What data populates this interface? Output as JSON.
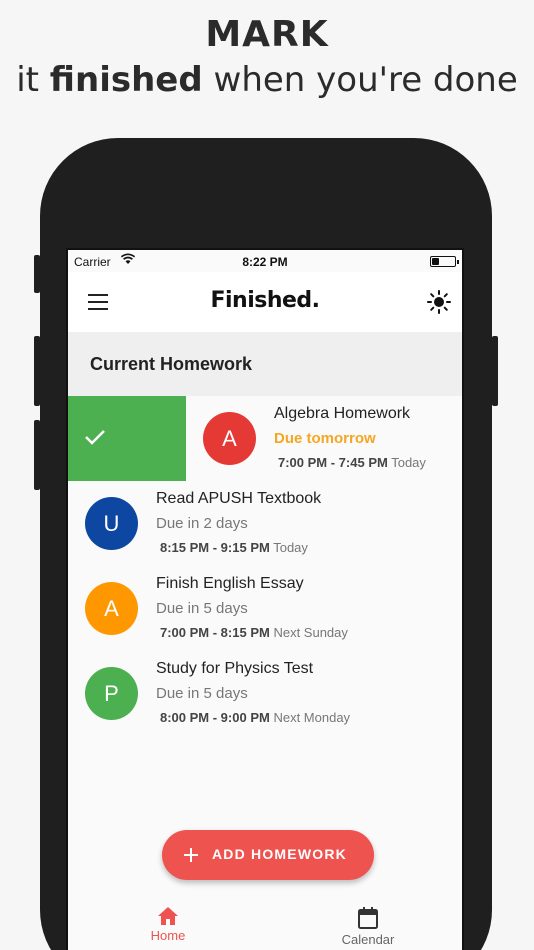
{
  "promo": {
    "headline_top": "MARK",
    "headline_pre": "it ",
    "headline_bold": "finished",
    "headline_post": " when you're done"
  },
  "status_bar": {
    "carrier": "Carrier",
    "time": "8:22 PM",
    "battery_level": 0.3
  },
  "app_bar": {
    "title": "Finished.",
    "left_icon": "menu-icon",
    "right_icon": "sun-icon"
  },
  "section": {
    "title": "Current Homework"
  },
  "homework": [
    {
      "initial": "A",
      "name": "Algebra Homework",
      "due": "Due tomorrow",
      "time_range": "7:00 PM - 7:45 PM",
      "day": "Today",
      "color": "#e53935",
      "urgent": true,
      "swiped": true
    },
    {
      "initial": "U",
      "name": "Read APUSH Textbook",
      "due": "Due in 2 days",
      "time_range": "8:15 PM - 9:15 PM",
      "day": "Today",
      "color": "#0d47a1",
      "urgent": false,
      "swiped": false
    },
    {
      "initial": "A",
      "name": "Finish English Essay",
      "due": "Due in 5 days",
      "time_range": "7:00 PM - 8:15 PM",
      "day": "Next Sunday",
      "color": "#ff9800",
      "urgent": false,
      "swiped": false
    },
    {
      "initial": "P",
      "name": "Study for Physics Test",
      "due": "Due in 5 days",
      "time_range": "8:00 PM - 9:00 PM",
      "day": "Next Monday",
      "color": "#4caf50",
      "urgent": false,
      "swiped": false
    }
  ],
  "fab": {
    "label": "ADD HOMEWORK",
    "icon": "plus-icon"
  },
  "bottom_nav": {
    "home_label": "Home",
    "calendar_label": "Calendar",
    "active": "home",
    "active_color": "#ef5350"
  },
  "colors": {
    "complete_swipe": "#4caf50",
    "urgent_due": "#f5a623",
    "accent": "#ef5350"
  }
}
